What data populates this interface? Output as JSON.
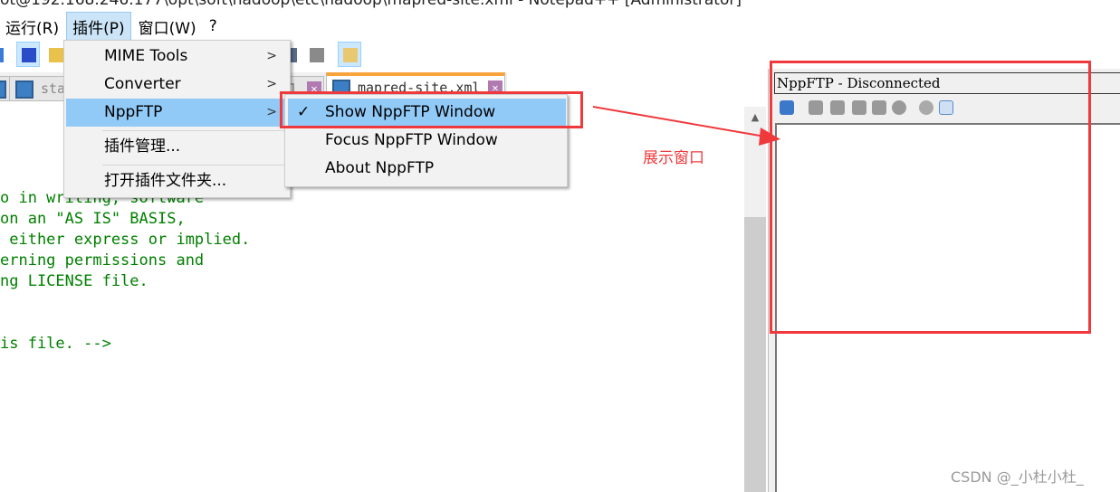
{
  "window": {
    "title": "ot@192.168.246.177\\opt\\soft\\hadoop\\etc\\hadoop\\mapred-site.xml - Notepad++ [Administrator]"
  },
  "menubar": {
    "items": [
      {
        "label": "运行(R)"
      },
      {
        "label": "插件(P)"
      },
      {
        "label": "窗口(W)"
      },
      {
        "label": "?"
      }
    ]
  },
  "tabs": [
    {
      "label": "sta"
    },
    {
      "label": "1"
    },
    {
      "label": "mapred-site.xml",
      "active": true
    }
  ],
  "editor": {
    "lines": [
      "o in writing, software",
      "on an \"AS IS\" BASIS,",
      " either express or implied.",
      "erning permissions and",
      "ng LICENSE file.",
      "",
      "",
      "is file. -->"
    ],
    "text_color": "#008000"
  },
  "plugins_menu": {
    "items": [
      {
        "label": "MIME Tools",
        "submenu": true
      },
      {
        "label": "Converter",
        "submenu": true
      },
      {
        "label": "NppFTP",
        "submenu": true,
        "highlighted": true
      },
      {
        "label": "插件管理..."
      },
      {
        "label": "打开插件文件夹..."
      }
    ]
  },
  "nppftp_submenu": {
    "items": [
      {
        "label": "Show NppFTP Window",
        "checked": true,
        "highlighted": true
      },
      {
        "label": "Focus NppFTP Window"
      },
      {
        "label": "About NppFTP"
      }
    ]
  },
  "nppftp_panel": {
    "title": "NppFTP - Disconnected",
    "toolbar_icons": [
      "connect-icon",
      "open-directory-icon",
      "download-icon",
      "upload-icon",
      "refresh-icon",
      "abort-icon",
      "settings-icon",
      "message-window-icon"
    ]
  },
  "annotation": {
    "label": "展示窗口",
    "color": "#f0393c"
  },
  "watermark": "CSDN @_小杜小杜_"
}
